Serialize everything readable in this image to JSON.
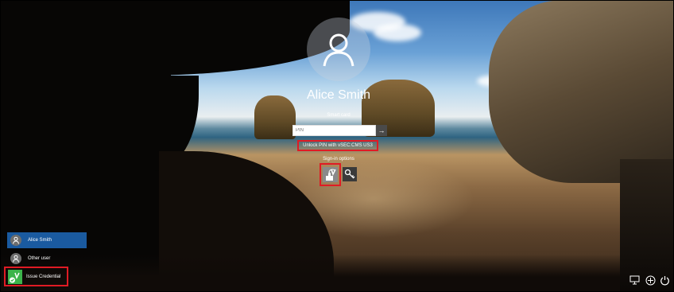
{
  "user": {
    "name": "Alice Smith"
  },
  "signin": {
    "smart_card_label": "Smart card",
    "pin_placeholder": "PIN",
    "unlock_link": "Unlock PIN with vSEC:CMS US3",
    "options_label": "Sign-in options",
    "submit_icon": "arrow-right-icon",
    "options": [
      {
        "name": "smart-card-credential-icon",
        "selected": true
      },
      {
        "name": "key-icon",
        "selected": false
      }
    ]
  },
  "users_list": [
    {
      "name": "Alice Smith",
      "selected": true,
      "icon": "user-icon"
    },
    {
      "name": "Other user",
      "selected": false,
      "icon": "user-icon"
    }
  ],
  "issue_credential": {
    "label": "Issue Credential",
    "icon": "credential-check-icon",
    "color": "#3cb44b"
  },
  "system_icons": [
    "network-icon",
    "ease-of-access-icon",
    "power-icon"
  ],
  "colors": {
    "highlight_border": "#e01b24",
    "selected_user_bg": "#1a5aa0"
  }
}
